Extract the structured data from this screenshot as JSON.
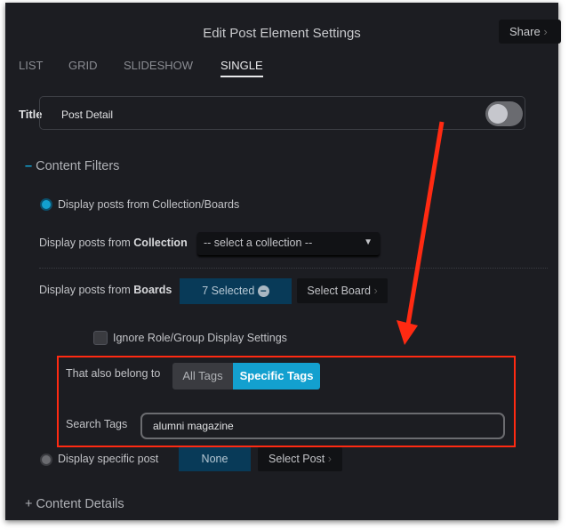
{
  "dialog": {
    "title": "Edit Post Element Settings",
    "share_label": "Share"
  },
  "tabs": [
    {
      "label": "LIST"
    },
    {
      "label": "GRID"
    },
    {
      "label": "SLIDESHOW"
    },
    {
      "label": "SINGLE",
      "active": true
    }
  ],
  "title_field": {
    "label": "Title",
    "value": "Post Detail",
    "toggle_on": false
  },
  "content_filters": {
    "header": "Content Filters",
    "option_collection_boards": "Display posts from Collection/Boards",
    "collection_label_prefix": "Display posts from ",
    "collection_label_bold": "Collection",
    "collection_select": "-- select a collection --",
    "boards_label_prefix": "Display posts from ",
    "boards_label_bold": "Boards",
    "boards_selected": "7 Selected",
    "select_board": "Select Board",
    "ignore_role": "Ignore Role/Group Display Settings",
    "also_belong_label": "That also belong to",
    "all_tags": "All Tags",
    "specific_tags": "Specific Tags",
    "search_tags_label": "Search Tags",
    "search_tags_value": "alumni magazine",
    "option_specific_post": "Display specific post",
    "specific_post_value": "None",
    "select_post": "Select Post"
  },
  "content_details": {
    "header": "Content Details"
  },
  "colors": {
    "accent": "#13a0cf",
    "annotation": "#ff2a12",
    "panel": "#1c1d22"
  }
}
